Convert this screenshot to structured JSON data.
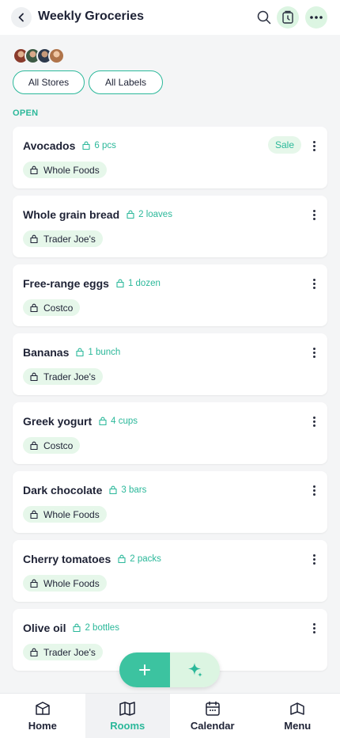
{
  "header": {
    "title": "Weekly Groceries"
  },
  "filters": {
    "stores": "All Stores",
    "labels": "All Labels"
  },
  "section": {
    "open": "OPEN"
  },
  "items": [
    {
      "name": "Avocados",
      "qty": "6 pcs",
      "store": "Whole Foods",
      "badge": "Sale"
    },
    {
      "name": "Whole grain bread",
      "qty": "2 loaves",
      "store": "Trader Joe's"
    },
    {
      "name": "Free-range eggs",
      "qty": "1 dozen",
      "store": "Costco"
    },
    {
      "name": "Bananas",
      "qty": "1 bunch",
      "store": "Trader Joe's"
    },
    {
      "name": "Greek yogurt",
      "qty": "4 cups",
      "store": "Costco"
    },
    {
      "name": "Dark chocolate",
      "qty": "3 bars",
      "store": "Whole Foods"
    },
    {
      "name": "Cherry tomatoes",
      "qty": "2 packs",
      "store": "Whole Foods"
    },
    {
      "name": "Olive oil",
      "qty": "2 bottles",
      "store": "Trader Joe's"
    }
  ],
  "nav": [
    {
      "label": "Home",
      "icon": "home-icon"
    },
    {
      "label": "Rooms",
      "icon": "rooms-icon",
      "active": true
    },
    {
      "label": "Calendar",
      "icon": "calendar-icon"
    },
    {
      "label": "Menu",
      "icon": "menu-icon"
    }
  ],
  "colors": {
    "accent": "#2bb89a",
    "accent_light": "#e6f7ea",
    "fab_add": "#3cc3a0",
    "text": "#1e2235",
    "background": "#f4f5f6"
  }
}
